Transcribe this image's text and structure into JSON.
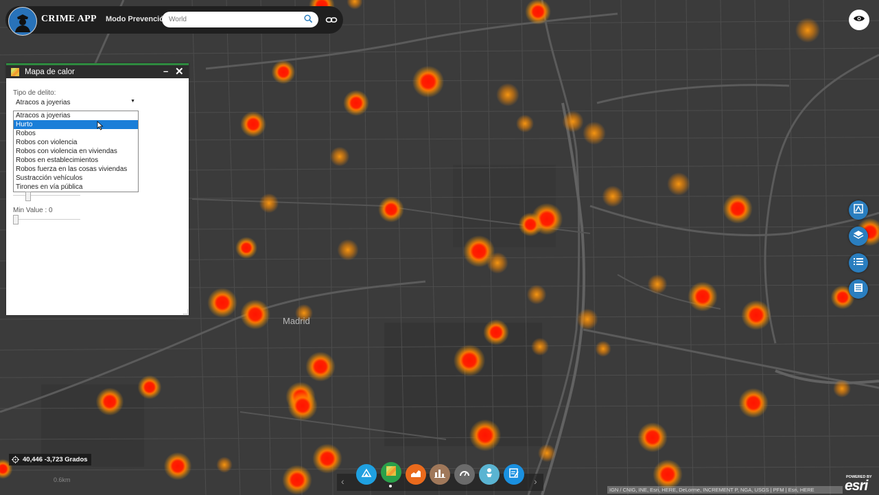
{
  "header": {
    "app_title": "CRIME APP",
    "subtitle": "Modo Prevención",
    "search_placeholder": "World"
  },
  "map": {
    "city_label": "Madrid",
    "scale_label": "0.6km",
    "coordinates": "40,446 -3,723 Grados",
    "attribution": "IGN / CNIG, INE, Esri, HERE, DeLorme, INCREMENT P, NGA, USGS | PFM | Esri, HERE",
    "powered_by": "POWERED BY",
    "esri": "esri"
  },
  "panel": {
    "title": "Mapa de calor",
    "minimize": "–",
    "close": "✕",
    "tipo_label": "Tipo de delito:",
    "tipo_selected": "Atracos a joyerias",
    "options": [
      {
        "label": "Atracos a joyerias",
        "selected": false
      },
      {
        "label": "Hurto",
        "selected": true
      },
      {
        "label": "Robos",
        "selected": false
      },
      {
        "label": "Robos con violencia",
        "selected": false
      },
      {
        "label": "Robos con violencia en viviendas",
        "selected": false
      },
      {
        "label": "Robos en establecimientos",
        "selected": false
      },
      {
        "label": "Robos fuerza en las cosas viviendas",
        "selected": false
      },
      {
        "label": "Sustracción vehículos",
        "selected": false
      },
      {
        "label": "Tirones en vía pública",
        "selected": false
      }
    ],
    "min_value_label": "Min Value : 0"
  },
  "right_tools": [
    "basemap-icon",
    "layers-icon",
    "legend-icon",
    "attribute-table-icon"
  ],
  "dock": {
    "items": [
      {
        "name": "measure-icon",
        "color": "#1fa0e0"
      },
      {
        "name": "heatmap-icon",
        "color": "#2aa04a",
        "active": true
      },
      {
        "name": "chart-icon",
        "color": "#ea6a1c"
      },
      {
        "name": "statistics-icon",
        "color": "#a0785a"
      },
      {
        "name": "gauge-icon",
        "color": "#6b6b6b"
      },
      {
        "name": "user-location-icon",
        "color": "#5ab4d2"
      },
      {
        "name": "report-icon",
        "color": "#1a90e0"
      }
    ]
  },
  "colors": {
    "dark_map": "#3c3c3c",
    "hotspot_red": "#ff1a00",
    "hotspot_orange": "#ff8c00",
    "panel_accent": "#2e8b3f",
    "selection": "#1a7ed8",
    "tool_blue": "#2a7ebf"
  }
}
